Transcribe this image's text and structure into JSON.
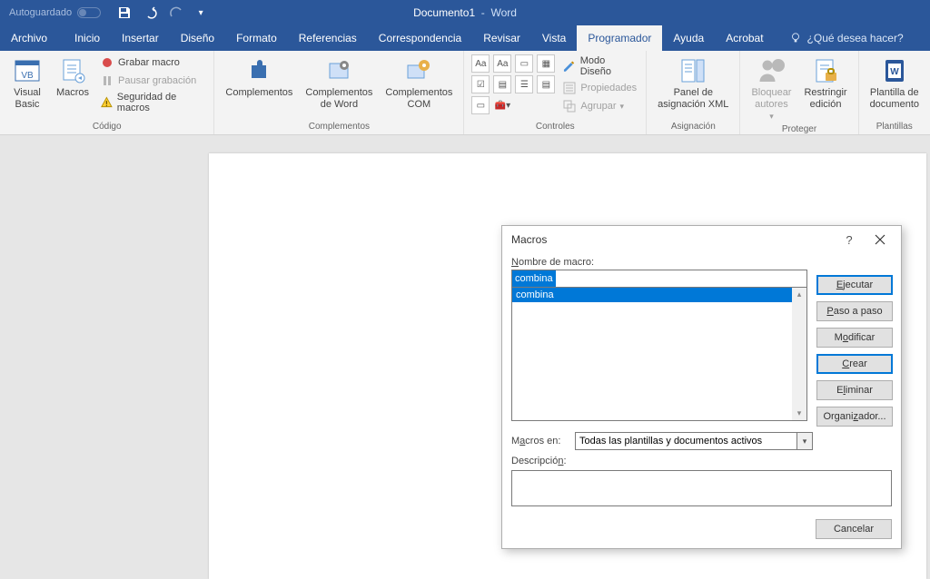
{
  "titlebar": {
    "autosave": "Autoguardado",
    "doc": "Documento1",
    "app": "Word"
  },
  "tabs": {
    "archivo": "Archivo",
    "inicio": "Inicio",
    "insertar": "Insertar",
    "diseno": "Diseño",
    "formato": "Formato",
    "referencias": "Referencias",
    "corresp": "Correspondencia",
    "revisar": "Revisar",
    "vista": "Vista",
    "programador": "Programador",
    "ayuda": "Ayuda",
    "acrobat": "Acrobat",
    "tell": "¿Qué desea hacer?"
  },
  "ribbon": {
    "codigo": {
      "visualbasic": "Visual\nBasic",
      "macros": "Macros",
      "grabar": "Grabar macro",
      "pausar": "Pausar grabación",
      "seguridad": "Seguridad de macros",
      "label": "Código"
    },
    "complementos": {
      "c1": "Complementos",
      "c2": "Complementos\nde Word",
      "c3": "Complementos\nCOM",
      "label": "Complementos"
    },
    "controles": {
      "diseno": "Modo Diseño",
      "propiedades": "Propiedades",
      "agrupar": "Agrupar",
      "label": "Controles"
    },
    "asignacion": {
      "panel": "Panel de\nasignación XML",
      "label": "Asignación"
    },
    "proteger": {
      "bloquear": "Bloquear\nautores",
      "restringir": "Restringir\nedición",
      "label": "Proteger"
    },
    "plantillas": {
      "plantilla": "Plantilla de\ndocumento",
      "label": "Plantillas"
    }
  },
  "dialog": {
    "title": "Macros",
    "nombre_label": "Nombre de macro:",
    "nombre_value": "combina",
    "list": {
      "item0": "combina"
    },
    "macros_en_label": "Macros en:",
    "macros_en_value": "Todas las plantillas y documentos activos",
    "descripcion_label": "Descripción:",
    "btn": {
      "ejecutar": "Ejecutar",
      "paso": "Paso a paso",
      "modificar": "Modificar",
      "crear": "Crear",
      "eliminar": "Eliminar",
      "organizador": "Organizador...",
      "cancelar": "Cancelar"
    }
  }
}
